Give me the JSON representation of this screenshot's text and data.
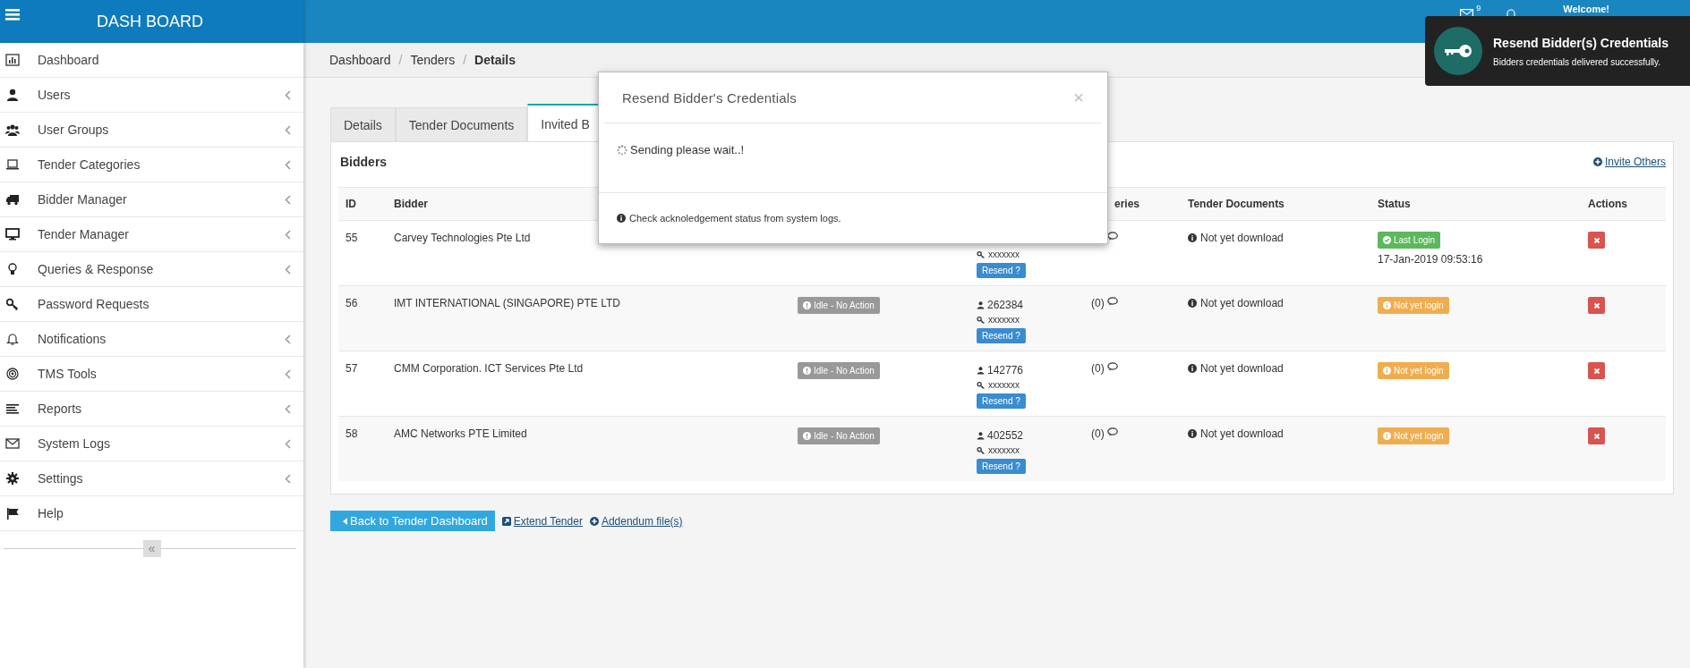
{
  "header": {
    "brand": "DASH BOARD",
    "mail_count": "9",
    "welcome": "Welcome!"
  },
  "sidebar": {
    "items": [
      {
        "label": "Dashboard",
        "has_submenu": false
      },
      {
        "label": "Users",
        "has_submenu": true
      },
      {
        "label": "User Groups",
        "has_submenu": true
      },
      {
        "label": "Tender Categories",
        "has_submenu": true
      },
      {
        "label": "Bidder Manager",
        "has_submenu": true
      },
      {
        "label": "Tender Manager",
        "has_submenu": true
      },
      {
        "label": "Queries & Response",
        "has_submenu": true
      },
      {
        "label": "Password Requests",
        "has_submenu": false
      },
      {
        "label": "Notifications",
        "has_submenu": true
      },
      {
        "label": "TMS Tools",
        "has_submenu": true
      },
      {
        "label": "Reports",
        "has_submenu": true
      },
      {
        "label": "System Logs",
        "has_submenu": true
      },
      {
        "label": "Settings",
        "has_submenu": true
      },
      {
        "label": "Help",
        "has_submenu": false
      }
    ],
    "collapse": "«"
  },
  "breadcrumb": {
    "separator": "/",
    "items": [
      "Dashboard",
      "Tenders",
      "Details"
    ]
  },
  "tabs": [
    {
      "label": "Details",
      "selected": false
    },
    {
      "label": "Tender Documents",
      "selected": false
    },
    {
      "label": "Invited B",
      "selected": true
    }
  ],
  "panel": {
    "title": "Bidders",
    "invite": "Invite Others"
  },
  "table": {
    "columns": [
      "ID",
      "Bidder",
      "",
      "",
      "eries",
      "Tender Documents",
      "Status",
      "Actions"
    ],
    "rows": [
      {
        "id": "55",
        "bidder": "Carvey Technologies Pte Ltd",
        "password": "xxxxxxx",
        "resend": "Resend ?",
        "documents": "Not yet download",
        "status": {
          "kind": "login",
          "label": "Last Login",
          "time": "17-Jan-2019 09:53:16"
        }
      },
      {
        "id": "56",
        "bidder": "IMT INTERNATIONAL (SINGAPORE) PTE LTD",
        "email_status": "Idle - No Action",
        "user": "262384",
        "password": "xxxxxxx",
        "resend": "Resend ?",
        "queries": "(0)",
        "documents": "Not yet download",
        "status": {
          "kind": "pending",
          "label": "Not yet login"
        }
      },
      {
        "id": "57",
        "bidder": "CMM Corporation. ICT Services Pte Ltd",
        "email_status": "Idle - No Action",
        "user": "142776",
        "password": "xxxxxxx",
        "resend": "Resend ?",
        "queries": "(0)",
        "documents": "Not yet download",
        "status": {
          "kind": "pending",
          "label": "Not yet login"
        }
      },
      {
        "id": "58",
        "bidder": "AMC Networks PTE Limited",
        "email_status": "Idle - No Action",
        "user": "402552",
        "password": "xxxxxxx",
        "resend": "Resend ?",
        "queries": "(0)",
        "documents": "Not yet download",
        "status": {
          "kind": "pending",
          "label": "Not yet login"
        }
      }
    ]
  },
  "footer_actions": [
    {
      "kind": "button",
      "label": "Back to Tender Dashboard"
    },
    {
      "kind": "link",
      "label": "Extend Tender"
    },
    {
      "kind": "link",
      "label": "Addendum file(s)"
    }
  ],
  "modal": {
    "title": "Resend Bidder's Credentials",
    "close": "×",
    "message": "Sending please wait..!",
    "note": "Check acknoledgement status from system logs."
  },
  "toast": {
    "title": "Resend Bidder(s) Credentials",
    "message": "Bidders credentials delivered successfully."
  }
}
